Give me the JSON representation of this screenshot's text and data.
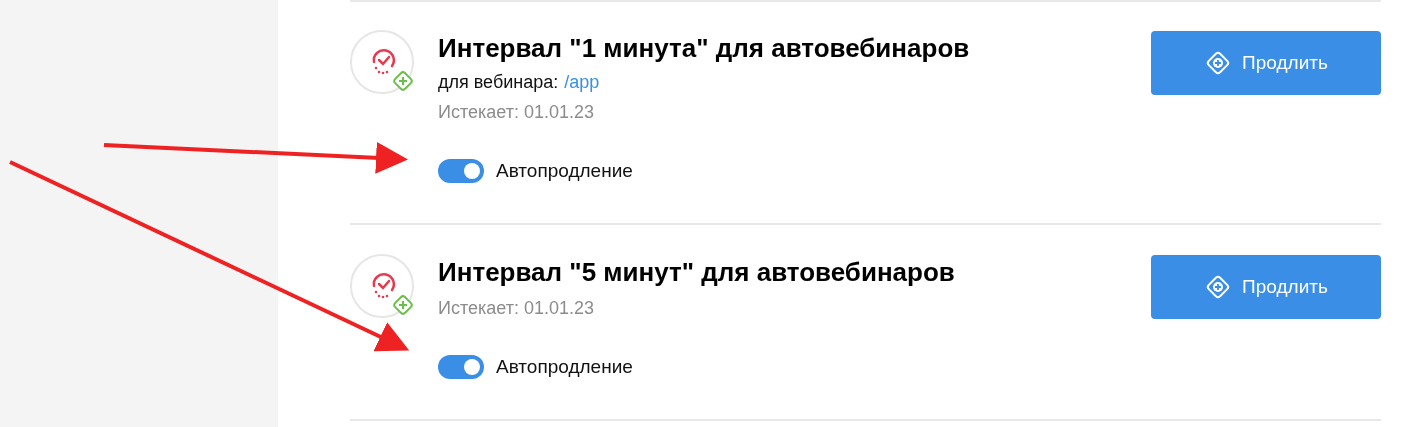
{
  "services": [
    {
      "title": "Интервал \"1 минута\" для автовебинаров",
      "webinar_label": "для вебинара:",
      "webinar_link": "/app",
      "expires": "Истекает: 01.01.23",
      "autorenew": {
        "label": "Автопродление",
        "on": true
      },
      "button": "Продлить"
    },
    {
      "title": "Интервал \"5 минут\" для автовебинаров",
      "expires": "Истекает: 01.01.23",
      "autorenew": {
        "label": "Автопродление",
        "on": true
      },
      "button": "Продлить"
    }
  ]
}
